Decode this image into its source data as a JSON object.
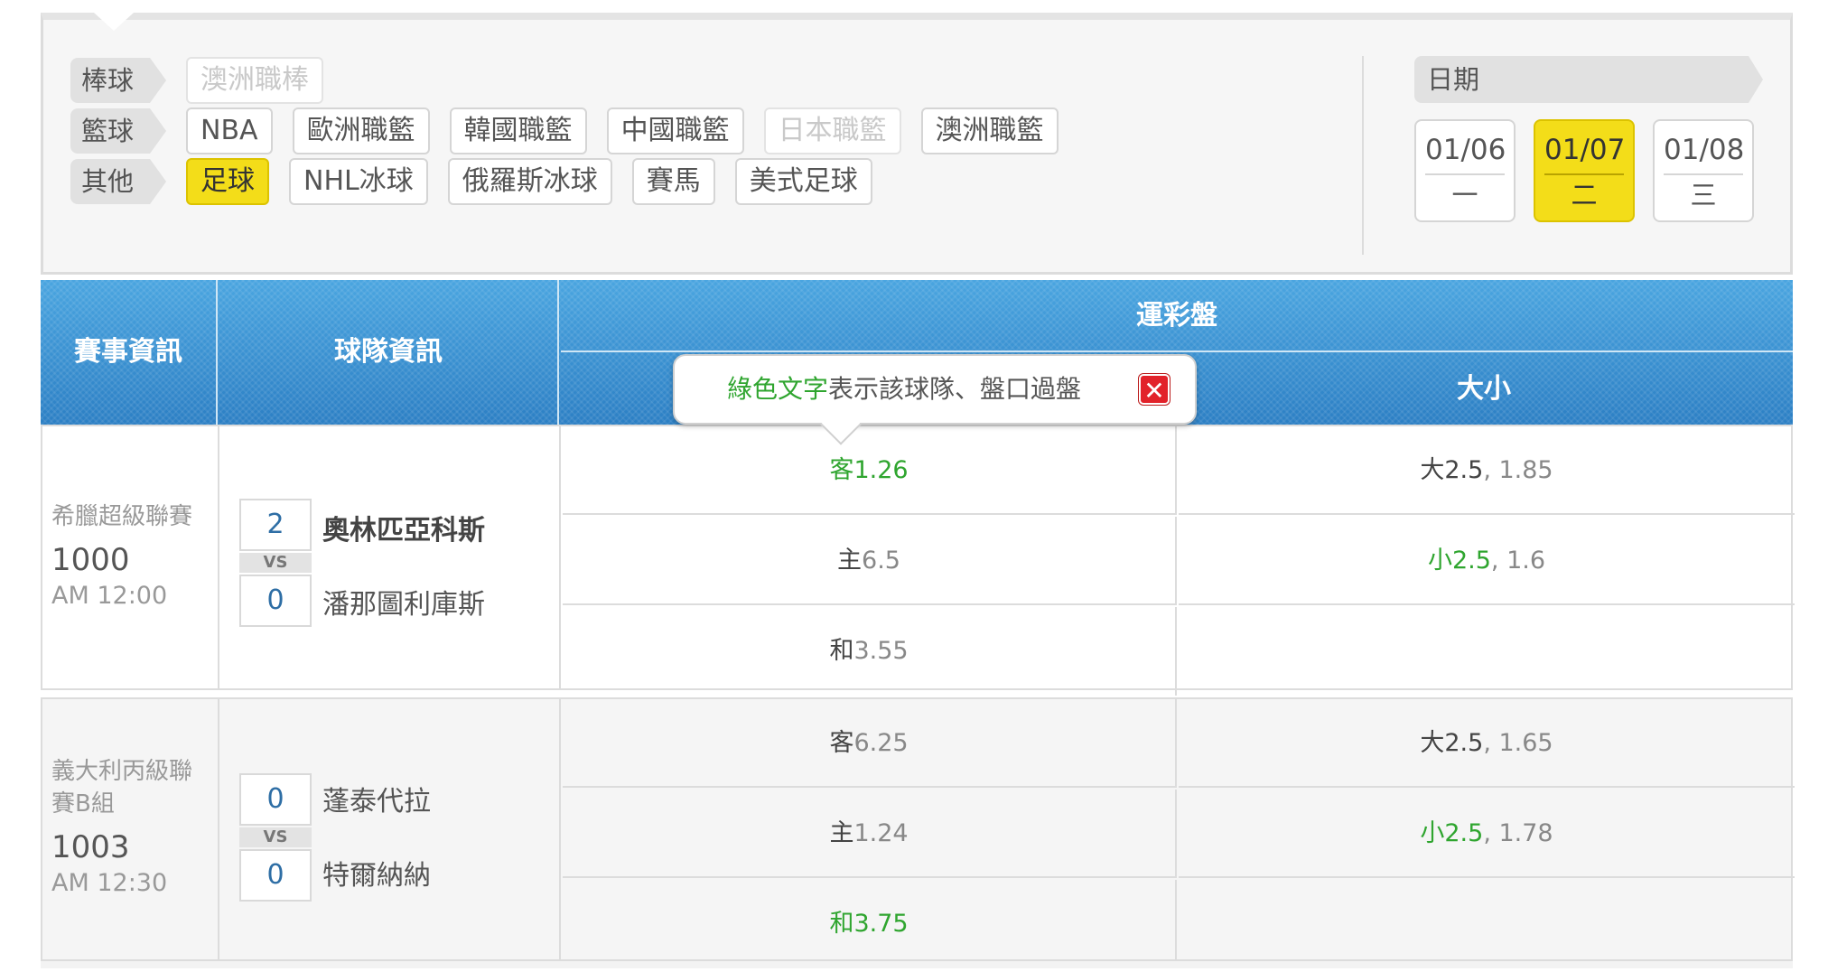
{
  "filters": {
    "rows": [
      {
        "label": "棒球",
        "chips": [
          {
            "text": "澳洲職棒",
            "state": "disabled"
          }
        ]
      },
      {
        "label": "籃球",
        "chips": [
          {
            "text": "NBA",
            "state": "normal"
          },
          {
            "text": "歐洲職籃",
            "state": "normal"
          },
          {
            "text": "韓國職籃",
            "state": "normal"
          },
          {
            "text": "中國職籃",
            "state": "normal"
          },
          {
            "text": "日本職籃",
            "state": "disabled"
          },
          {
            "text": "澳洲職籃",
            "state": "normal"
          }
        ]
      },
      {
        "label": "其他",
        "chips": [
          {
            "text": "足球",
            "state": "active"
          },
          {
            "text": "NHL冰球",
            "state": "normal"
          },
          {
            "text": "俄羅斯冰球",
            "state": "normal"
          },
          {
            "text": "賽馬",
            "state": "normal"
          },
          {
            "text": "美式足球",
            "state": "normal"
          }
        ]
      }
    ]
  },
  "dates": {
    "label": "日期",
    "items": [
      {
        "date": "01/06",
        "weekday": "一",
        "active": false
      },
      {
        "date": "01/07",
        "weekday": "二",
        "active": true
      },
      {
        "date": "01/08",
        "weekday": "三",
        "active": false
      }
    ]
  },
  "table_header": {
    "event_info": "賽事資訊",
    "team_info": "球隊資訊",
    "lottery_odds": "運彩盤",
    "over_under": "大小"
  },
  "tooltip": {
    "green_text": "綠色文字",
    "rest_text": "表示該球隊、盤口過盤",
    "close": "✕"
  },
  "matches": [
    {
      "league": "希臘超級聯賽",
      "number": "1000",
      "time": "AM 12:00",
      "vs": "VS",
      "teams": [
        {
          "score": "2",
          "name": "奧林匹亞科斯",
          "bold": true
        },
        {
          "score": "0",
          "name": "潘那圖利庫斯",
          "bold": false
        }
      ],
      "odds": [
        {
          "label": "客",
          "value": "1.26",
          "green": true
        },
        {
          "label": "主",
          "value": "6.5",
          "green": false
        },
        {
          "label": "和",
          "value": "3.55",
          "green": false
        }
      ],
      "ou": [
        {
          "label": "大",
          "line": "2.5",
          "value": ", 1.85",
          "green": false
        },
        {
          "label": "小",
          "line": "2.5",
          "value": ", 1.6",
          "green": true
        }
      ]
    },
    {
      "league": "義大利丙級聯賽B組",
      "number": "1003",
      "time": "AM 12:30",
      "vs": "VS",
      "teams": [
        {
          "score": "0",
          "name": "蓬泰代拉",
          "bold": false
        },
        {
          "score": "0",
          "name": "特爾納納",
          "bold": false
        }
      ],
      "odds": [
        {
          "label": "客",
          "value": "6.25",
          "green": false
        },
        {
          "label": "主",
          "value": "1.24",
          "green": false
        },
        {
          "label": "和",
          "value": "3.75",
          "green": true
        }
      ],
      "ou": [
        {
          "label": "大",
          "line": "2.5",
          "value": ", 1.65",
          "green": false
        },
        {
          "label": "小",
          "line": "2.5",
          "value": ", 1.78",
          "green": true
        }
      ]
    }
  ],
  "colors": {
    "accent_yellow": "#f3dd19",
    "header_blue": "#2f83c8",
    "win_green": "#2fa52f",
    "close_red": "#e2222a"
  }
}
